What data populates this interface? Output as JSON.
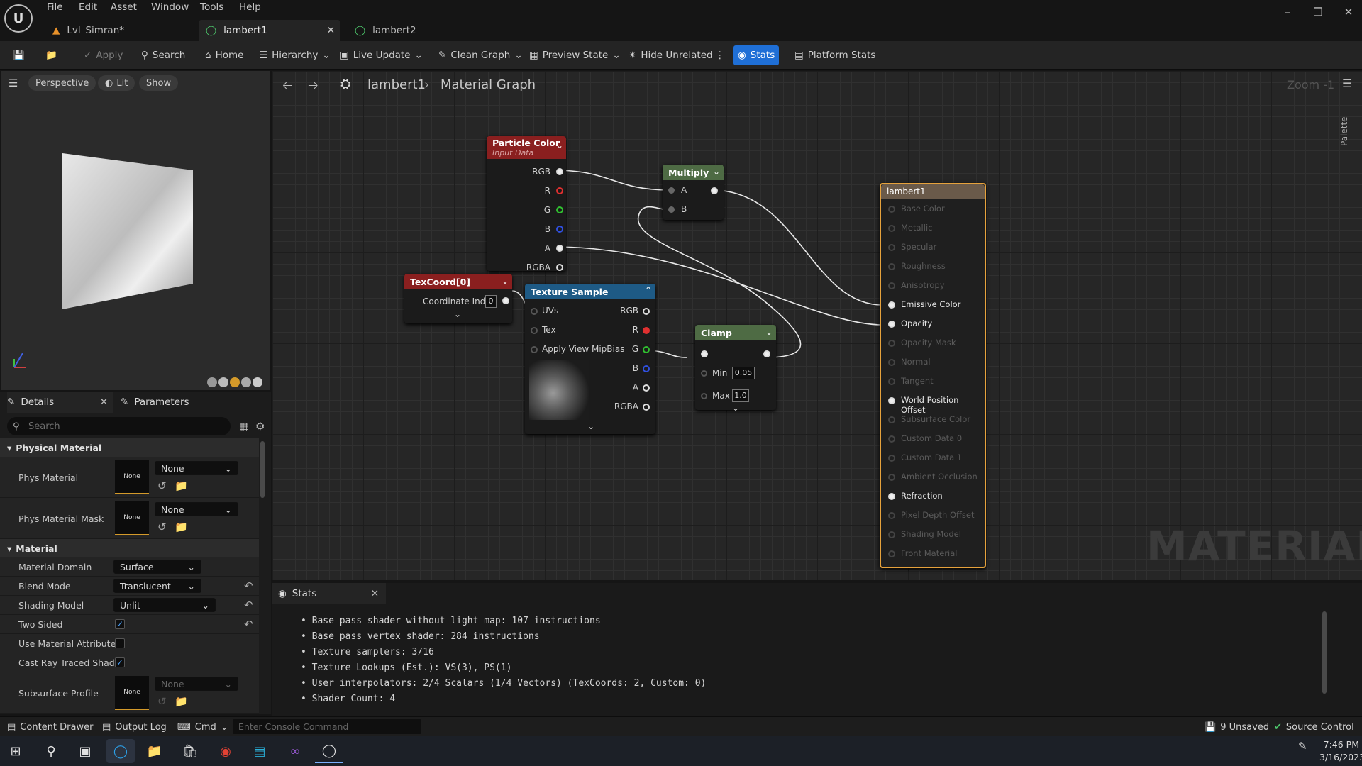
{
  "menu": [
    "File",
    "Edit",
    "Asset",
    "Window",
    "Tools",
    "Help"
  ],
  "tabs": [
    {
      "label": "Lvl_Simran*"
    },
    {
      "label": "lambert1"
    },
    {
      "label": "lambert2"
    }
  ],
  "toolbar": {
    "apply": "Apply",
    "search": "Search",
    "home": "Home",
    "hierarchy": "Hierarchy",
    "live_update": "Live Update",
    "clean_graph": "Clean Graph",
    "preview_state": "Preview State",
    "hide_unrelated": "Hide Unrelated",
    "stats": "Stats",
    "platform_stats": "Platform Stats"
  },
  "viewport": {
    "perspective": "Perspective",
    "lit": "Lit",
    "show": "Show"
  },
  "details": {
    "tab_details": "Details",
    "tab_parameters": "Parameters",
    "search_placeholder": "Search",
    "section_physical": "Physical Material",
    "phys_material": {
      "label": "Phys Material",
      "thumb": "None",
      "value": "None"
    },
    "phys_material_mask": {
      "label": "Phys Material Mask",
      "thumb": "None",
      "value": "None"
    },
    "section_material": "Material",
    "material_domain": {
      "label": "Material Domain",
      "value": "Surface"
    },
    "blend_mode": {
      "label": "Blend Mode",
      "value": "Translucent"
    },
    "shading_model": {
      "label": "Shading Model",
      "value": "Unlit"
    },
    "two_sided": {
      "label": "Two Sided",
      "checked": true
    },
    "use_material_attributes": {
      "label": "Use Material Attributes",
      "checked": false
    },
    "cast_ray_traced": {
      "label": "Cast Ray Traced Shad...",
      "checked": true
    },
    "subsurface_profile": {
      "label": "Subsurface Profile",
      "thumb": "None",
      "value": "None"
    }
  },
  "graph": {
    "breadcrumb_asset": "lambert1",
    "breadcrumb_graph": "Material Graph",
    "zoom": "Zoom -1",
    "watermark": "MATERIAL",
    "palette": "Palette",
    "particle_color": {
      "title": "Particle Color",
      "subtitle": "Input Data",
      "pins": [
        "RGB",
        "R",
        "G",
        "B",
        "A",
        "RGBA"
      ]
    },
    "multiply": {
      "title": "Multiply",
      "pins": [
        "A",
        "B"
      ]
    },
    "texcoord": {
      "title": "TexCoord[0]",
      "param_label": "Coordinate Index",
      "param_value": "0"
    },
    "texture_sample": {
      "title": "Texture Sample",
      "inputs": [
        "UVs",
        "Tex",
        "Apply View MipBias"
      ],
      "outputs": [
        "RGB",
        "R",
        "G",
        "B",
        "A",
        "RGBA"
      ]
    },
    "clamp": {
      "title": "Clamp",
      "min_label": "Min",
      "min_value": "0.05",
      "max_label": "Max",
      "max_value": "1.0"
    },
    "result": {
      "title": "lambert1",
      "inputs": [
        "Base Color",
        "Metallic",
        "Specular",
        "Roughness",
        "Anisotropy",
        "Emissive Color",
        "Opacity",
        "Opacity Mask",
        "Normal",
        "Tangent",
        "World Position Offset",
        "Subsurface Color",
        "Custom Data 0",
        "Custom Data 1",
        "Ambient Occlusion",
        "Refraction",
        "Pixel Depth Offset",
        "Shading Model",
        "Front Material"
      ],
      "active": [
        "Emissive Color",
        "Opacity",
        "World Position Offset",
        "Refraction"
      ]
    }
  },
  "stats": {
    "title": "Stats",
    "lines": [
      "Base pass shader without light map: 107 instructions",
      "Base pass vertex shader: 284 instructions",
      "Texture samplers: 3/16",
      "Texture Lookups (Est.): VS(3), PS(1)",
      "User interpolators: 2/4 Scalars (1/4 Vectors) (TexCoords: 2, Custom: 0)",
      "Shader Count: 4"
    ]
  },
  "statusbar": {
    "content_drawer": "Content Drawer",
    "output_log": "Output Log",
    "cmd": "Cmd",
    "console_placeholder": "Enter Console Command",
    "unsaved": "9 Unsaved",
    "source_control": "Source Control"
  },
  "taskbar": {
    "time": "7:46 PM",
    "date": "3/16/2023"
  },
  "colors": {
    "accent": "#1f6fd6",
    "selected_node": "#e6a23c",
    "particle_header": "#8a1f1f",
    "multiply_header": "#4e6b44",
    "texture_header": "#1e5a85",
    "clamp_header": "#4e6b44"
  }
}
